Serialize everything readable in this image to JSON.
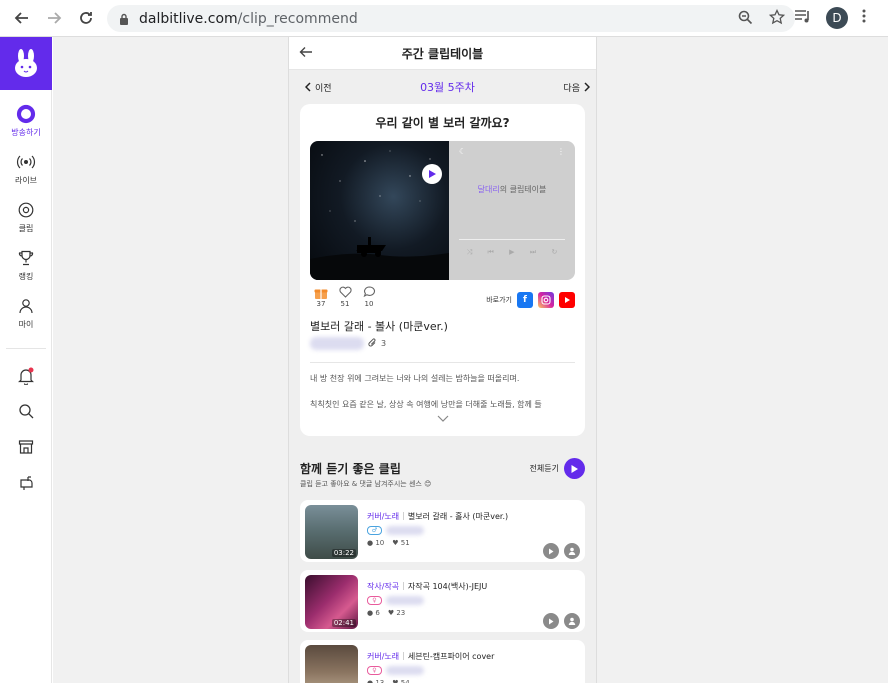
{
  "browser": {
    "url_host": "dalbitlive.com",
    "url_path": "/clip_recommend",
    "profile_initial": "D"
  },
  "sidebar": {
    "items": [
      {
        "label": "방송하기",
        "icon": "broadcast-icon",
        "active": true
      },
      {
        "label": "라이브",
        "icon": "live-icon"
      },
      {
        "label": "클립",
        "icon": "clip-icon"
      },
      {
        "label": "랭킹",
        "icon": "trophy-icon"
      },
      {
        "label": "마이",
        "icon": "person-icon"
      }
    ],
    "bottom_icons": [
      "bell-icon",
      "search-icon",
      "store-icon",
      "mailbox-icon"
    ]
  },
  "app": {
    "title": "주간 클립테이블",
    "prev_label": "이전",
    "next_label": "다음",
    "week_label": "03월 5주차",
    "featured": {
      "heading": "우리 같이 별 보러 갈까요?",
      "panel_title_accent": "달대리",
      "panel_title_rest": "의 클립테이블",
      "gifts": "37",
      "likes": "51",
      "comments": "10",
      "goto_label": "바로가기",
      "song": "별보러 갈래 - 볼사 (마쿤ver.)",
      "clip_count": "3",
      "desc_line1": "내 방 천장 위에 그려보는 너와 나의 설레는 밤하늘을 떠올리며.",
      "desc_line2": "칙칙칫인 요즘 같은 날, 상상 속 여행에 낭만을 더해줄 노래들, 함께 들"
    },
    "section": {
      "title": "함께 듣기 좋은 클립",
      "subtitle": "클립 듣고 좋아요 & 댓글 남겨주시는 센스 😊",
      "all_label": "전체듣기"
    },
    "clips": [
      {
        "category": "커버/노래",
        "title": "별보러 갈래 - 홀사 (마쿤ver.)",
        "duration": "03:22",
        "comments": "10",
        "likes": "51",
        "gender_color": "#4aa3df"
      },
      {
        "category": "작사/작곡",
        "title": "자작곡 104(백사)-JEJU",
        "duration": "02:41",
        "comments": "6",
        "likes": "23",
        "gender_color": "#e85b9c"
      },
      {
        "category": "커버/노래",
        "title": "세븐틴-캠프파이어 cover",
        "duration": "",
        "comments": "13",
        "likes": "54",
        "gender_color": "#e85b9c"
      }
    ]
  },
  "colors": {
    "brand": "#632beb",
    "facebook": "#1877f2",
    "instagram": "#d6249f",
    "youtube": "#ff0000"
  }
}
